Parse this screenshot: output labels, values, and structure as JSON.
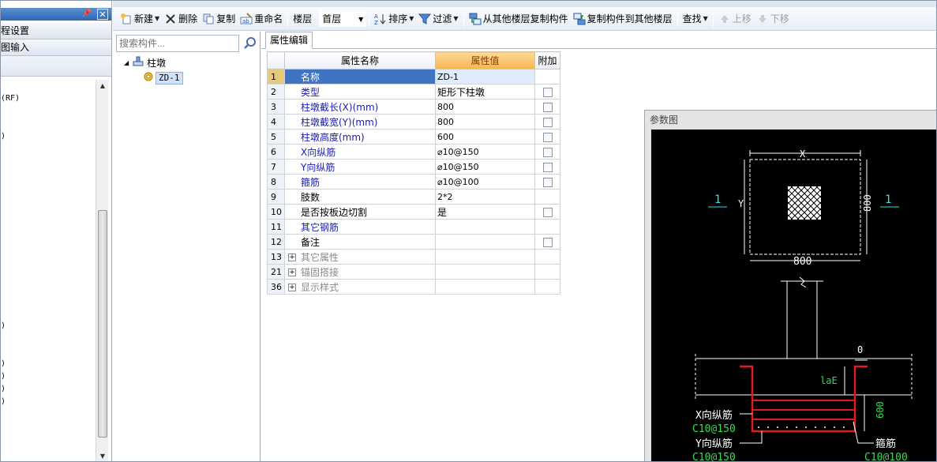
{
  "nav": {
    "items": [
      "程设置",
      "图输入"
    ],
    "rows": [
      "(RF)",
      ")",
      ")",
      ")",
      ")",
      ")",
      ")"
    ]
  },
  "toolbar": {
    "new_label": "新建",
    "delete_label": "删除",
    "copy_label": "复制",
    "rename_label": "重命名",
    "floor_label": "楼层",
    "floor_value": "首层",
    "sort_label": "排序",
    "filter_label": "过滤",
    "copy_from_label": "从其他楼层复制构件",
    "copy_to_label": "复制构件到其他楼层",
    "find_label": "查找",
    "up_label": "上移",
    "down_label": "下移"
  },
  "tree": {
    "search_placeholder": "搜索构件...",
    "root_label": "柱墩",
    "child_label": "ZD-1"
  },
  "tab": {
    "label": "属性编辑"
  },
  "grid": {
    "headers": {
      "name": "属性名称",
      "value": "属性值",
      "extra": "附加"
    },
    "rows": [
      {
        "num": "1",
        "name": "名称",
        "value": "ZD-1"
      },
      {
        "num": "2",
        "name": "类型",
        "value": "矩形下柱墩"
      },
      {
        "num": "3",
        "name": "柱墩截长(X)(mm)",
        "value": "800"
      },
      {
        "num": "4",
        "name": "柱墩截宽(Y)(mm)",
        "value": "800"
      },
      {
        "num": "5",
        "name": "柱墩高度(mm)",
        "value": "600"
      },
      {
        "num": "6",
        "name": "X向纵筋",
        "value": "⌀10@150"
      },
      {
        "num": "7",
        "name": "Y向纵筋",
        "value": "⌀10@150"
      },
      {
        "num": "8",
        "name": "箍筋",
        "value": "⌀10@100"
      },
      {
        "num": "9",
        "name": "肢数",
        "value": "2*2"
      },
      {
        "num": "10",
        "name": "是否按板边切割",
        "value": "是"
      },
      {
        "num": "11",
        "name": "其它钢筋",
        "value": ""
      },
      {
        "num": "12",
        "name": "备注",
        "value": ""
      },
      {
        "num": "13",
        "name": "其它属性",
        "value": ""
      },
      {
        "num": "21",
        "name": "锚固搭接",
        "value": ""
      },
      {
        "num": "36",
        "name": "显示样式",
        "value": ""
      }
    ]
  },
  "param": {
    "title": "参数图",
    "labels": {
      "x": "X",
      "y": "Y",
      "dim_x": "800",
      "dim_y": "800",
      "section_left": "1",
      "section_right": "1",
      "zero": "0",
      "lae": "laE",
      "h600": "600",
      "x_bar": "X向纵筋",
      "x_bar_val": "C10@150",
      "y_bar": "Y向纵筋",
      "y_bar_val": "C10@150",
      "stirrup": "箍筋",
      "stirrup_val": "C10@100"
    }
  }
}
